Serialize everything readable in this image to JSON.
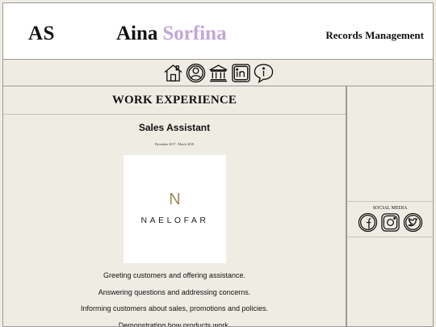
{
  "header": {
    "initials": "AS",
    "first_name": "Aina",
    "last_name": "Sorfina",
    "role": "Records Management"
  },
  "nav": {
    "icons": [
      "home-icon",
      "profile-icon",
      "institution-icon",
      "linkedin-icon",
      "info-icon"
    ]
  },
  "main": {
    "section_title": "WORK EXPERIENCE",
    "job": {
      "title": "Sales Assistant",
      "dates": "December 2017 - March 2018",
      "logo_mark": "N",
      "logo_text": "NAELOFAR",
      "duties": [
        "Greeting customers and offering assistance.",
        "Answering questions and addressing concerns.",
        "Informing customers about sales, promotions and policies.",
        "Demonstrating how products work."
      ]
    }
  },
  "sidebar": {
    "social_title": "SOCIAL MEDIA",
    "social_icons": [
      "facebook-icon",
      "instagram-icon",
      "twitter-icon"
    ]
  },
  "colors": {
    "background": "#efece3",
    "accent_lilac": "#c2a7d6",
    "logo_gold": "#a08a5c"
  }
}
